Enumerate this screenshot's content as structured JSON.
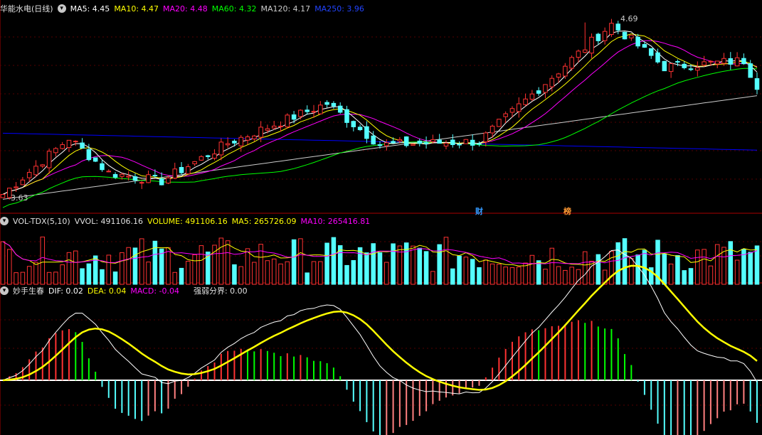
{
  "colors": {
    "up": "#ff3232",
    "down": "#54ffff",
    "ma5": "#ffffff",
    "ma10": "#ffff00",
    "ma20": "#ff00ff",
    "ma60": "#00ff00",
    "ma120": "#cccccc",
    "ma250": "#0000ff",
    "dif": "#ffffff",
    "dea": "#ffff00",
    "macd_pos_rise": "#ff3232",
    "macd_pos_fall": "#00ff00",
    "macd_neg_fall": "#54ffff",
    "macd_neg_rise": "#ff7f7f"
  },
  "main": {
    "title": "华能水电(日线)",
    "ma5": "MA5: 4.45",
    "ma10": "MA10: 4.47",
    "ma20": "MA20: 4.48",
    "ma60": "MA60: 4.32",
    "ma120": "MA120: 4.17",
    "ma250": "MA250: 3.96",
    "high_label": "4.69",
    "low_label": "3.63",
    "marker_cai": "财",
    "marker_bang": "榜"
  },
  "vol": {
    "title": "VOL-TDX(5,10)",
    "vvol": "VVOL: 491106.16",
    "volume": "VOLUME: 491106.16",
    "ma5": "MA5: 265726.09",
    "ma10": "MA10: 265416.81"
  },
  "macd": {
    "title": "妙手生春",
    "dif": "DIF: 0.02",
    "dea": "DEA: 0.04",
    "macd": "MACD: -0.04",
    "boundary": "强弱分界: 0.00"
  },
  "chart_data": {
    "type": "candlestick",
    "y_range": [
      3.6,
      4.74
    ],
    "days": 115,
    "high": 4.69,
    "low": 3.63,
    "start_close": 3.65,
    "peaks": [
      [
        0,
        3.65
      ],
      [
        10,
        3.99
      ],
      [
        16,
        3.78
      ],
      [
        24,
        3.73
      ],
      [
        34,
        3.96
      ],
      [
        49,
        4.2
      ],
      [
        57,
        3.95
      ],
      [
        72,
        3.97
      ],
      [
        92,
        4.68
      ],
      [
        100,
        4.42
      ],
      [
        112,
        4.46
      ],
      [
        114,
        4.31
      ]
    ],
    "ma_labels": [
      "MA5",
      "MA10",
      "MA20",
      "MA60",
      "MA120",
      "MA250"
    ],
    "volume_range": [
      0,
      600000
    ],
    "macd_range": [
      -0.12,
      0.16
    ]
  }
}
